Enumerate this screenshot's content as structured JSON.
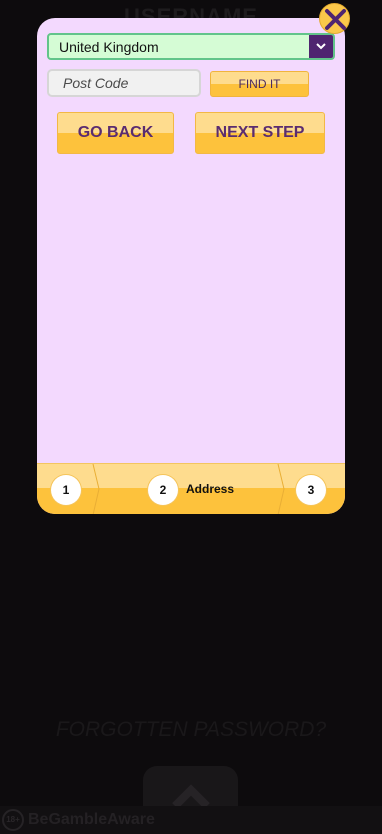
{
  "background": {
    "username_heading": "USERNAME",
    "forgotten_password": "FORGOTTEN PASSWORD?",
    "footer_text": "BeGambleAware",
    "footer_icon_text": "18+"
  },
  "modal": {
    "country": {
      "value": "United Kingdom",
      "icon": "chevron-down-icon"
    },
    "postcode": {
      "placeholder": "Post Code",
      "value": ""
    },
    "find_button": "FIND IT",
    "go_back_button": "GO BACK",
    "next_step_button": "NEXT STEP",
    "close_icon": "close-icon",
    "stepper": {
      "steps": [
        {
          "number": "1",
          "label": ""
        },
        {
          "number": "2",
          "label": "Address"
        },
        {
          "number": "3",
          "label": ""
        }
      ],
      "current_step": 2
    }
  },
  "colors": {
    "modal_bg": "#f3d9fe",
    "button_yellow": "#fdc23c",
    "button_light": "#fedc8e",
    "accent_purple": "#4f2570",
    "select_green": "#d5fcd5"
  }
}
